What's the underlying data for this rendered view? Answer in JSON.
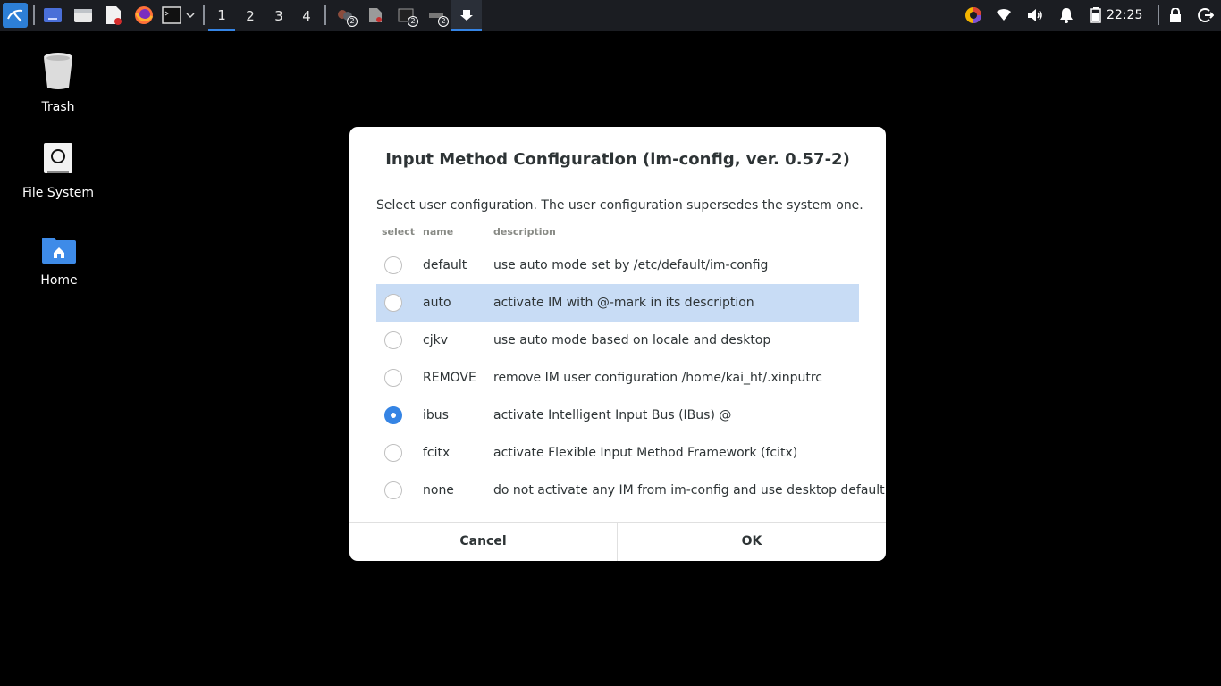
{
  "taskbar": {
    "workspaces": [
      "1",
      "2",
      "3",
      "4"
    ],
    "active_workspace": "1",
    "badges": {
      "tray_app_1": "2",
      "tray_app_3": "2",
      "tray_app_4": "2"
    },
    "clock": "22:25",
    "accent_color": "#3584e4"
  },
  "desktop": {
    "icons": [
      {
        "label": "Trash",
        "icon": "trash-icon"
      },
      {
        "label": "File System",
        "icon": "drive-icon"
      },
      {
        "label": "Home",
        "icon": "home-folder-icon"
      }
    ]
  },
  "dialog": {
    "title": "Input Method Configuration (im-config, ver. 0.57-2)",
    "message": "Select user configuration. The user configuration supersedes the system one.",
    "columns": {
      "select": "select",
      "name": "name",
      "description": "description"
    },
    "rows": [
      {
        "name": "default",
        "description": "use auto mode set by /etc/default/im-config",
        "checked": false,
        "highlighted": false
      },
      {
        "name": "auto",
        "description": "activate IM with @-mark in its description",
        "checked": false,
        "highlighted": true
      },
      {
        "name": "cjkv",
        "description": "use auto mode based on locale and desktop",
        "checked": false,
        "highlighted": false
      },
      {
        "name": "REMOVE",
        "description": "remove IM user configuration /home/kai_ht/.xinputrc",
        "checked": false,
        "highlighted": false
      },
      {
        "name": "ibus",
        "description": "activate Intelligent Input Bus (IBus) @",
        "checked": true,
        "highlighted": false
      },
      {
        "name": "fcitx",
        "description": "activate Flexible Input Method Framework (fcitx)",
        "checked": false,
        "highlighted": false
      },
      {
        "name": "none",
        "description": "do not activate any IM from im-config and use desktop default",
        "checked": false,
        "highlighted": false
      }
    ],
    "cancel_label": "Cancel",
    "ok_label": "OK",
    "highlight_color": "#c8dcf5"
  }
}
